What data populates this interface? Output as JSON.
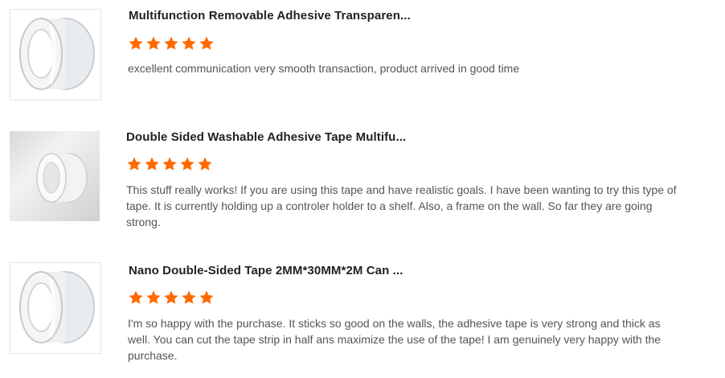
{
  "colors": {
    "star": "#ff6a00",
    "title": "#222222",
    "body": "#555555"
  },
  "reviews": [
    {
      "image_icon": "tape-roll-icon",
      "title": "Multifunction Removable Adhesive Transparen...",
      "rating": 5,
      "text": "excellent communication very smooth transaction, product arrived in good time"
    },
    {
      "image_icon": "tape-roll-photo",
      "title": "Double Sided Washable Adhesive Tape Multifu...",
      "rating": 5,
      "text": "This stuff really works! If you are using this tape and have realistic goals. I have been wanting to try this type of tape. It is currently holding up a controler holder to a shelf. Also, a frame on the wall. So far they are going strong."
    },
    {
      "image_icon": "tape-roll-icon",
      "title": "Nano Double-Sided Tape 2MM*30MM*2M Can ...",
      "rating": 5,
      "text": "I'm so happy with the purchase. It sticks so good on the walls, the adhesive tape is very strong and thick as well. You can cut the tape strip in half ans maximize the use of the tape! I am genuinely very happy with the purchase."
    }
  ]
}
